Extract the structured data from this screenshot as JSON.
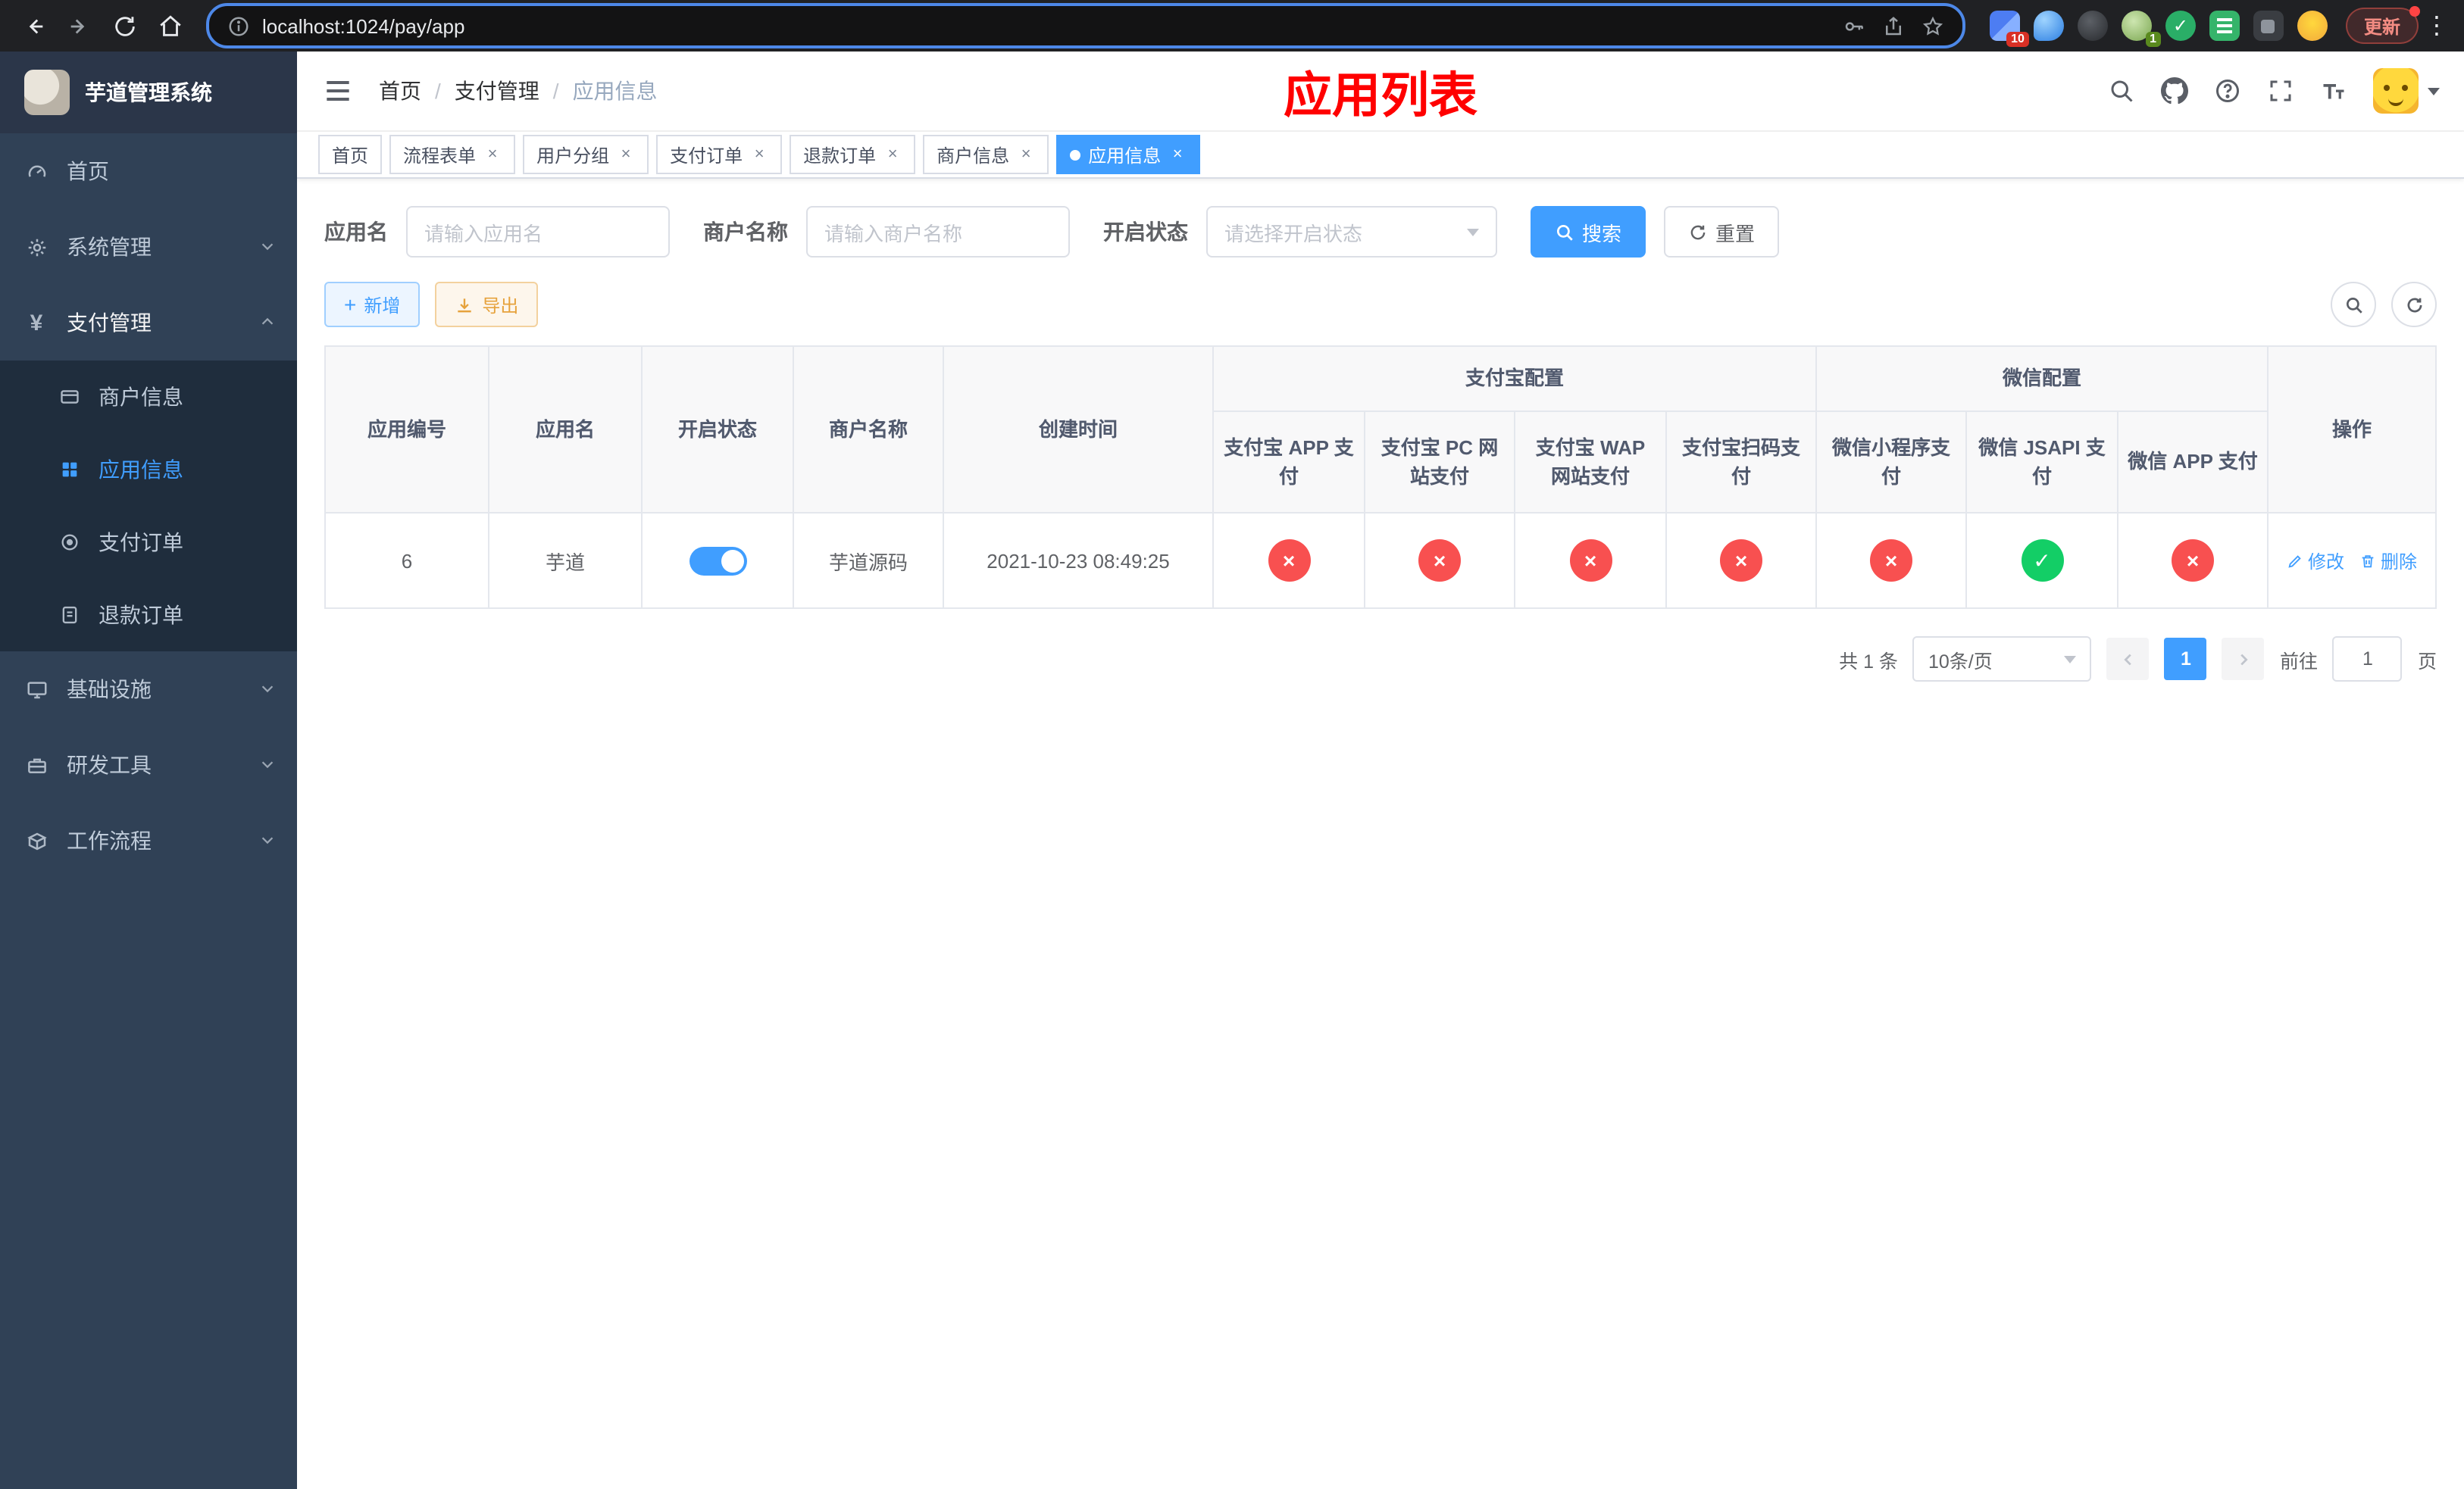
{
  "theme": {
    "accent": "#409eff",
    "danger": "#f85050",
    "success": "#13ce66",
    "warning": "#e6a23c",
    "annotation": "#ff0000"
  },
  "browser": {
    "url": "localhost:1024/pay/app",
    "update_label": "更新",
    "ext_badge_1": "10",
    "ext_badge_2": "1"
  },
  "sidebar": {
    "logo_title": "芋道管理系统",
    "items": {
      "home": "首页",
      "system": "系统管理",
      "pay": "支付管理",
      "infra": "基础设施",
      "devtools": "研发工具",
      "workflow": "工作流程"
    },
    "pay_children": {
      "merchant": "商户信息",
      "app": "应用信息",
      "order": "支付订单",
      "refund": "退款订单"
    }
  },
  "header": {
    "breadcrumb": {
      "b1": "首页",
      "b2": "支付管理",
      "b3": "应用信息"
    },
    "annotation": "应用列表"
  },
  "tabs": [
    {
      "label": "首页"
    },
    {
      "label": "流程表单"
    },
    {
      "label": "用户分组"
    },
    {
      "label": "支付订单"
    },
    {
      "label": "退款订单"
    },
    {
      "label": "商户信息"
    },
    {
      "label": "应用信息"
    }
  ],
  "filters": {
    "app_name_label": "应用名",
    "app_name_placeholder": "请输入应用名",
    "merchant_label": "商户名称",
    "merchant_placeholder": "请输入商户名称",
    "status_label": "开启状态",
    "status_placeholder": "请选择开启状态",
    "search_label": "搜索",
    "reset_label": "重置"
  },
  "toolbar": {
    "add_label": "新增",
    "export_label": "导出"
  },
  "table": {
    "columns": [
      "应用编号",
      "应用名",
      "开启状态",
      "商户名称",
      "创建时间"
    ],
    "groups": [
      {
        "label": "支付宝配置",
        "children": [
          "支付宝 APP 支付",
          "支付宝 PC 网站支付",
          "支付宝 WAP 网站支付",
          "支付宝扫码支付"
        ]
      },
      {
        "label": "微信配置",
        "children": [
          "微信小程序支付",
          "微信 JSAPI 支付",
          "微信 APP 支付"
        ]
      }
    ],
    "ops_label": "操作",
    "row": {
      "id": "6",
      "name": "芋道",
      "merchant": "芋道源码",
      "created": "2021-10-23 08:49:25",
      "configs": [
        "no",
        "no",
        "no",
        "no",
        "no",
        "yes",
        "no"
      ],
      "edit_label": "修改",
      "delete_label": "删除"
    }
  },
  "pagination": {
    "total_label": "共 1 条",
    "page_size": "10条/页",
    "current": "1",
    "goto_label": "前往",
    "goto_value": "1",
    "page_label": "页"
  }
}
